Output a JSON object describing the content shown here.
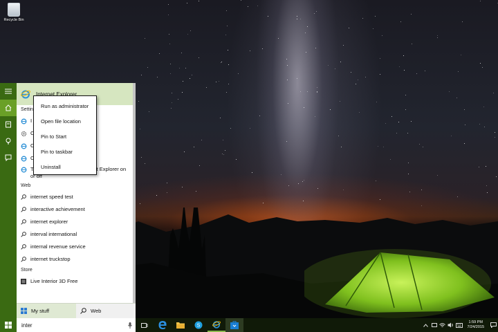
{
  "desktop": {
    "recycle_bin_label": "Recycle Bin"
  },
  "search_panel": {
    "top_hit": {
      "name": "Internet Explorer",
      "icon": "internet-explorer-icon"
    },
    "settings_header": "Settings",
    "settings_items": [
      {
        "label": "I",
        "icon": "ie-settings-icon"
      },
      {
        "label": "C",
        "icon": "gear-icon"
      },
      {
        "label": "C…le settings",
        "icon": "ie-settings-icon"
      },
      {
        "label": "C…n Internet E",
        "icon": "ie-settings-icon"
      },
      {
        "label": "Turn autocomplete in Internet Explorer on or off",
        "icon": "ie-settings-icon"
      }
    ],
    "web_header": "Web",
    "web_items": [
      "internet speed test",
      "interactive achievement",
      "internet explorer",
      "interval international",
      "internal revenue service",
      "internet truckstop"
    ],
    "store_header": "Store",
    "store_items": [
      "Live Interior 3D Free"
    ],
    "footer": {
      "my_stuff": "My stuff",
      "web": "Web"
    }
  },
  "context_menu": {
    "items": [
      "Run as administrator",
      "Open file location",
      "Pin to Start",
      "Pin to taskbar",
      "Uninstall"
    ]
  },
  "taskbar": {
    "search_value": "inter",
    "apps": [
      "task-view-icon",
      "edge-icon",
      "file-explorer-icon",
      "skype-icon",
      "internet-explorer-icon",
      "store-icon"
    ],
    "clock_time": "1:59 PM",
    "clock_date": "7/24/2015",
    "accent": "#3a6a12"
  }
}
